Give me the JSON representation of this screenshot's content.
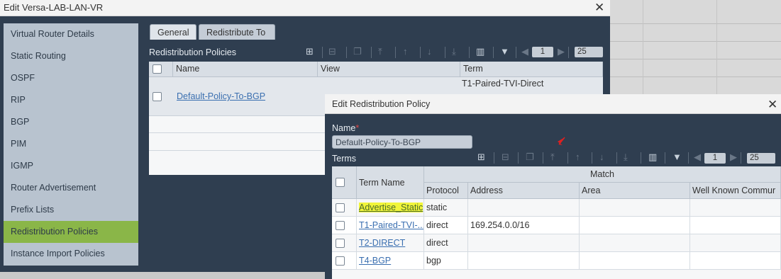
{
  "outer_dialog": {
    "title": "Edit Versa-LAB-LAN-VR",
    "close_symbol": "✕",
    "sidebar": [
      {
        "label": "Virtual Router Details"
      },
      {
        "label": "Static Routing"
      },
      {
        "label": "OSPF"
      },
      {
        "label": "RIP"
      },
      {
        "label": "BGP"
      },
      {
        "label": "PIM"
      },
      {
        "label": "IGMP"
      },
      {
        "label": "Router Advertisement"
      },
      {
        "label": "Prefix Lists"
      },
      {
        "label": "Redistribution Policies",
        "active": true
      },
      {
        "label": "Instance Import Policies"
      }
    ],
    "tabs": [
      {
        "label": "General",
        "active": true
      },
      {
        "label": "Redistribute To"
      }
    ],
    "section_title": "Redistribution Policies",
    "pager": {
      "page": "1",
      "page_size": "25"
    },
    "table": {
      "columns": [
        "Name",
        "View",
        "Term"
      ],
      "rows": [
        {
          "name": "Default-Policy-To-BGP",
          "term": "T1-Paired-TVI-Direct"
        }
      ]
    }
  },
  "inner_dialog": {
    "title": "Edit Redistribution Policy",
    "close_symbol": "✕",
    "name_label": "Name",
    "required_mark": "*",
    "name_value": "Default-Policy-To-BGP",
    "terms_label": "Terms",
    "pager": {
      "page": "1",
      "page_size": "25"
    },
    "table": {
      "group_header": "Match",
      "columns": [
        "Term Name",
        "Protocol",
        "Address",
        "Area",
        "Well Known Commur"
      ],
      "rows": [
        {
          "term_name": "Advertise_Static",
          "protocol": "static",
          "address": "",
          "highlighted": true
        },
        {
          "term_name": "T1-Paired-TVI-...",
          "protocol": "direct",
          "address": "169.254.0.0/16"
        },
        {
          "term_name": "T2-DIRECT",
          "protocol": "direct",
          "address": ""
        },
        {
          "term_name": "T4-BGP",
          "protocol": "bgp",
          "address": ""
        }
      ]
    }
  },
  "colors": {
    "dialog_bg": "#2f3e50",
    "active_sidebar": "#8ab648",
    "highlight": "#f1f53a",
    "link": "#3a6fb0",
    "cursor_arrow": "#e02020"
  },
  "icons": [
    "add-icon",
    "remove-icon",
    "copy-icon",
    "move-top-icon",
    "move-up-icon",
    "move-down-icon",
    "move-bottom-icon",
    "columns-icon",
    "filter-icon",
    "prev-page-icon",
    "next-page-icon",
    "close-icon",
    "red-cursor-arrow-icon"
  ]
}
